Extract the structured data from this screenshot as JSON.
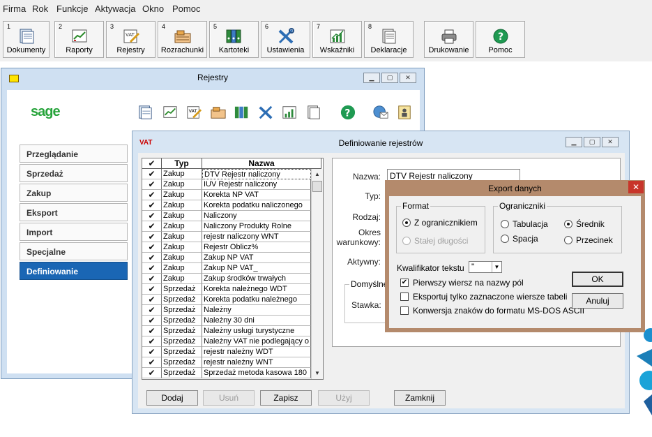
{
  "menu": [
    "Firma",
    "Rok",
    "Funkcje",
    "Aktywacja",
    "Okno",
    "Pomoc"
  ],
  "toolbar": [
    {
      "num": "1",
      "label": "Dokumenty",
      "icon": "documents-icon"
    },
    {
      "num": "2",
      "label": "Raporty",
      "icon": "reports-icon"
    },
    {
      "num": "3",
      "label": "Rejestry",
      "icon": "vat-registers-icon"
    },
    {
      "num": "4",
      "label": "Rozrachunki",
      "icon": "settlements-icon"
    },
    {
      "num": "5",
      "label": "Kartoteki",
      "icon": "binders-icon"
    },
    {
      "num": "6",
      "label": "Ustawienia",
      "icon": "tools-icon"
    },
    {
      "num": "7",
      "label": "Wskaźniki",
      "icon": "indicators-chart-icon"
    },
    {
      "num": "8",
      "label": "Deklaracje",
      "icon": "declarations-icon"
    },
    {
      "num": "",
      "label": "Drukowanie",
      "icon": "printer-icon"
    },
    {
      "num": "",
      "label": "Pomoc",
      "icon": "help-icon"
    }
  ],
  "rejestry_window": {
    "title": "Rejestry",
    "logo": "sage",
    "nav": [
      "Przeglądanie",
      "Sprzedaż",
      "Zakup",
      "Eksport",
      "Import",
      "Specjalne",
      "Definiowanie"
    ],
    "active_nav": "Definiowanie"
  },
  "definitions_window": {
    "title": "Definiowanie rejestrów",
    "columns": [
      "Typ",
      "Nazwa"
    ],
    "check_glyph": "✔",
    "rows": [
      [
        "Zakup",
        "DTV Rejestr naliczony"
      ],
      [
        "Zakup",
        "IUV Rejestr naliczony"
      ],
      [
        "Zakup",
        "Korekta NP VAT"
      ],
      [
        "Zakup",
        "Korekta podatku naliczonego"
      ],
      [
        "Zakup",
        "Naliczony"
      ],
      [
        "Zakup",
        "Naliczony Produkty Rolne"
      ],
      [
        "Zakup",
        "rejestr naliczony WNT"
      ],
      [
        "Zakup",
        "Rejestr Oblicz%"
      ],
      [
        "Zakup",
        "Zakup NP VAT"
      ],
      [
        "Zakup",
        "Zakup NP VAT_"
      ],
      [
        "Zakup",
        "Zakup środków trwałych"
      ],
      [
        "Sprzedaż",
        "Korekta należnego WDT"
      ],
      [
        "Sprzedaż",
        "Korekta podatku należnego"
      ],
      [
        "Sprzedaż",
        "Należny"
      ],
      [
        "Sprzedaż",
        "Należny 30 dni"
      ],
      [
        "Sprzedaż",
        "Należny usługi turystyczne"
      ],
      [
        "Sprzedaż",
        "Należny VAT nie podlegający o"
      ],
      [
        "Sprzedaż",
        "rejestr należny WDT"
      ],
      [
        "Sprzedaż",
        "rejestr należny WNT"
      ],
      [
        "Sprzedaż",
        "Sprzedaż metoda kasowa 180"
      ]
    ],
    "form": {
      "nazwa_label": "Nazwa:",
      "nazwa_value": "DTV Rejestr naliczony",
      "typ_label": "Typ:",
      "rodzaj_label": "Rodzaj:",
      "okres_label_1": "Okres",
      "okres_label_2": "warunkowy:",
      "aktywny_label": "Aktywny:",
      "domyslne_legend": "Domyślne",
      "stawka_label": "Stawka:"
    },
    "buttons": {
      "dodaj": "Dodaj",
      "usun": "Usuń",
      "zapisz": "Zapisz",
      "uzyj": "Użyj",
      "zamknij": "Zamknij"
    }
  },
  "export_dialog": {
    "title": "Export danych",
    "format_legend": "Format",
    "format_options": [
      "Z ogranicznikiem",
      "Stałej długości"
    ],
    "separators_legend": "Ograniczniki",
    "separator_options": [
      "Tabulacja",
      "Średnik",
      "Spacja",
      "Przecinek"
    ],
    "selected_separator": "Średnik",
    "qualifier_label": "Kwalifikator tekstu",
    "qualifier_value": "\"",
    "checkboxes": [
      {
        "label": "Pierwszy wiersz na nazwy pól",
        "checked": true
      },
      {
        "label": "Eksportuj tylko zaznaczone wiersze tabeli",
        "checked": false
      },
      {
        "label": "Konwersja znaków do formatu MS-DOS ASCII",
        "checked": false
      }
    ],
    "ok": "OK",
    "cancel": "Anuluj"
  },
  "colors": {
    "active_nav": "#1a66b4",
    "window_frame": "#cfe0f2",
    "dialog_frame": "#b48a6c",
    "close_button": "#c8352a"
  }
}
